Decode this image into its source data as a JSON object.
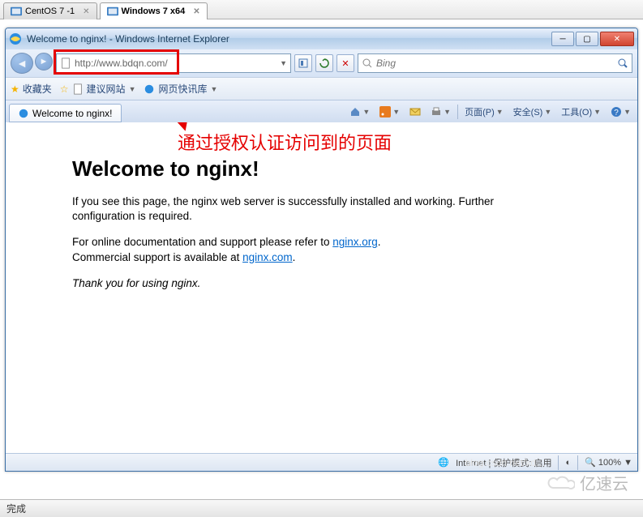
{
  "vmtabs": [
    {
      "label": "CentOS 7 -1",
      "active": false
    },
    {
      "label": "Windows 7 x64",
      "active": true
    }
  ],
  "window": {
    "title": "Welcome to nginx! - Windows Internet Explorer"
  },
  "nav": {
    "url_display": "http://www.bdqn.com/",
    "search_placeholder": "Bing"
  },
  "favbar": {
    "favorites": "收藏夹",
    "suggested": "建议网站",
    "feeds": "网页快讯库"
  },
  "pagetab": {
    "label": "Welcome to nginx!"
  },
  "tabtools": {
    "page": "页面(P)",
    "safety": "安全(S)",
    "tools": "工具(O)"
  },
  "annotation": "通过授权认证访问到的页面",
  "nginx": {
    "heading": "Welcome to nginx!",
    "p1": "If you see this page, the nginx web server is successfully installed and working. Further configuration is required.",
    "p2a": "For online documentation and support please refer to ",
    "link1": "nginx.org",
    "p2b": ".",
    "p3a": "Commercial support is available at ",
    "link2": "nginx.com",
    "p3b": ".",
    "thanks": "Thank you for using nginx."
  },
  "status": {
    "internet": "Internet | 保护模式: 启用",
    "zoom": "100%"
  },
  "appstatus": "完成",
  "watermark": "亿速云",
  "faint_url": "blog.csdn.net/xd…"
}
